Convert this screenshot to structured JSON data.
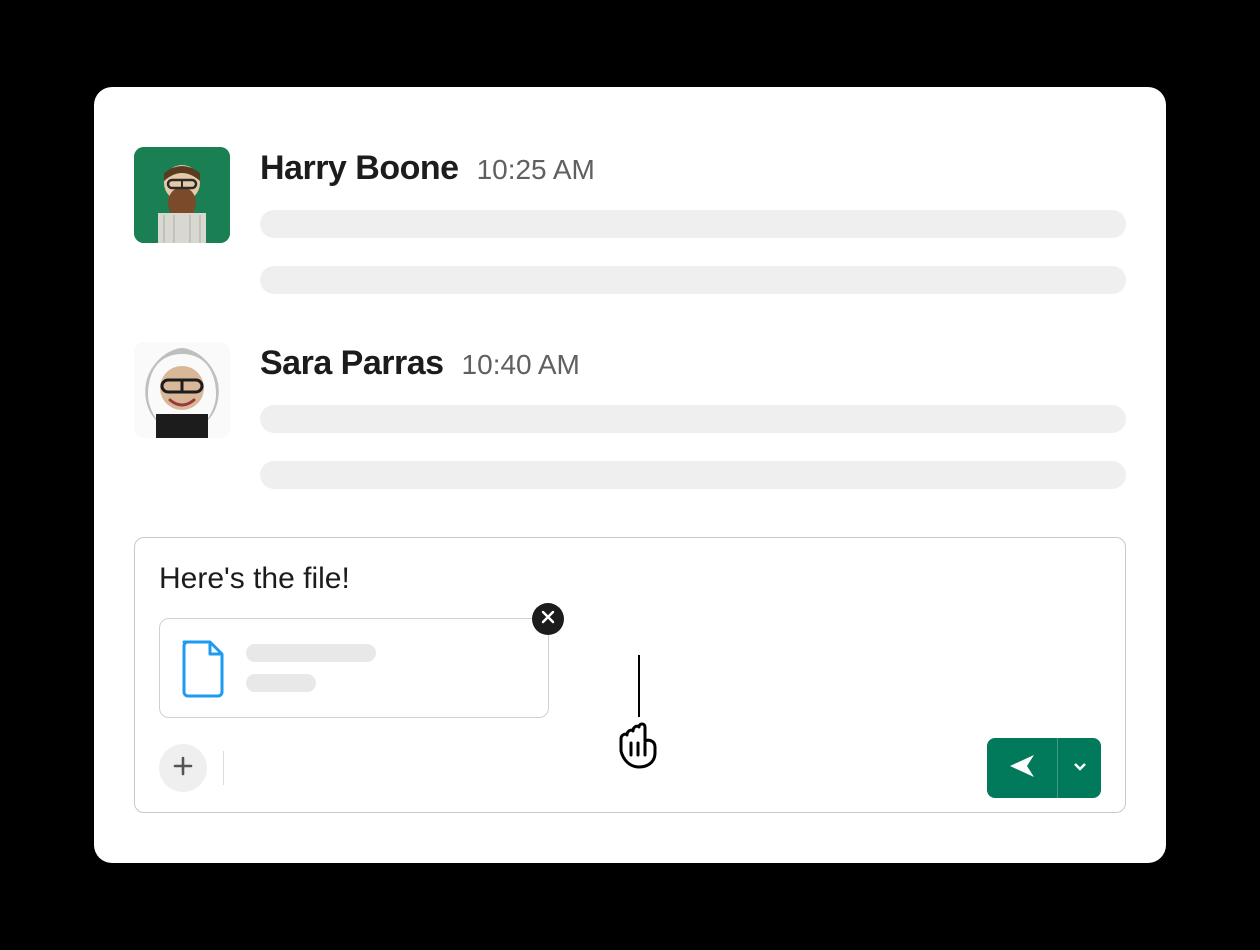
{
  "messages": [
    {
      "name": "Harry Boone",
      "time": "10:25 AM"
    },
    {
      "name": "Sara Parras",
      "time": "10:40 AM"
    }
  ],
  "composer": {
    "text": "Here's the file!"
  },
  "colors": {
    "send": "#007a5a"
  }
}
